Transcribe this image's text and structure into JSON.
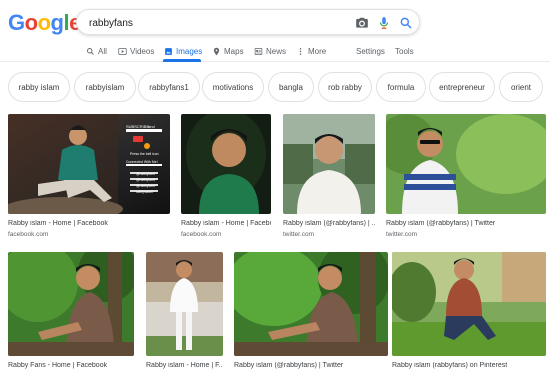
{
  "logo": "Google",
  "colors": {
    "blue": "#4285f4",
    "red": "#ea4335",
    "yellow": "#fbbc05",
    "green": "#34a853",
    "active_tab": "#1a73e8"
  },
  "search": {
    "query": "rabbyfans",
    "icons": [
      "camera-icon",
      "microphone-icon",
      "search-icon"
    ]
  },
  "tabs": [
    {
      "label": "All",
      "icon": "search-icon"
    },
    {
      "label": "Videos",
      "icon": "play-icon"
    },
    {
      "label": "Images",
      "icon": "image-icon",
      "active": true
    },
    {
      "label": "Maps",
      "icon": "map-pin-icon"
    },
    {
      "label": "News",
      "icon": "news-icon"
    },
    {
      "label": "More",
      "icon": "more-vertical-icon"
    }
  ],
  "tools": {
    "settings": "Settings",
    "tools": "Tools"
  },
  "chips": [
    "rabby islam",
    "rabbyislam",
    "rabbyfans1",
    "motivations",
    "bangla",
    "rob rabby",
    "formula",
    "entrepreneur",
    "orient"
  ],
  "results": [
    {
      "title": "Rabby islam - Home | Facebook",
      "source": "facebook.com"
    },
    {
      "title": "Rabby islam - Home | Facebook",
      "source": "facebook.com"
    },
    {
      "title": "Rabby islam (@rabbyfans) | ...",
      "source": "twitter.com"
    },
    {
      "title": "Rabby islam (@rabbyfans) | Twitter",
      "source": "twitter.com"
    },
    {
      "title": "Rabby Fans - Home | Facebook",
      "source": ""
    },
    {
      "title": "Rabby islam - Home | F...",
      "source": ""
    },
    {
      "title": "Rabby islam (@rabbyfans) | Twitter",
      "source": ""
    },
    {
      "title": "Rabby islam (rabbyfans) on Pinterest",
      "source": ""
    }
  ],
  "banner": {
    "subscribe": "SUBSCRIBE",
    "and": "and",
    "press_bell": "Press the bell icon",
    "connected": "Connected With Me!",
    "handles": [
      "@rabbyfans",
      "@rabbyfans",
      "@rabbyfans",
      "rabbyislam"
    ]
  }
}
